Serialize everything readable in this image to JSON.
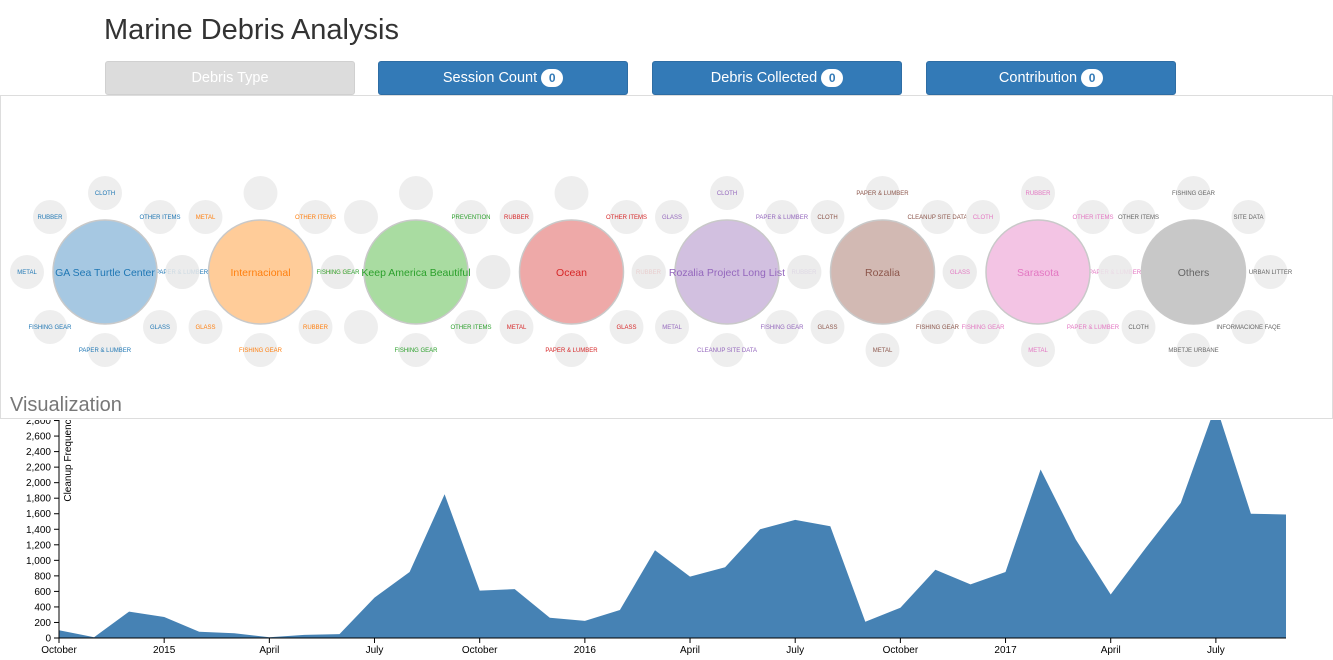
{
  "header": {
    "title": "Marine Debris Analysis"
  },
  "tabs": [
    {
      "label": "Debris Type",
      "badge": null
    },
    {
      "label": "Session Count",
      "badge": "0"
    },
    {
      "label": "Debris Collected",
      "badge": "0"
    },
    {
      "label": "Contribution",
      "badge": "0"
    }
  ],
  "section": {
    "label": "Visualization"
  },
  "groups": [
    {
      "name": "GA Sea Turtle Center",
      "color": "#a6c8e2",
      "text_color": "#1f77b4",
      "satellites": [
        "CLOTH",
        "OTHER ITEMS",
        "PAPER & LUMBER",
        "GLASS",
        "PAPER & LUMBER",
        "FISHING GEAR",
        "METAL",
        "RUBBER"
      ]
    },
    {
      "name": "Internacional",
      "color": "#ffcc99",
      "text_color": "#ff7f0e",
      "satellites": [
        "",
        "OTHER ITEMS",
        "PLASTIC",
        "RUBBER",
        "FISHING GEAR",
        "GLASS",
        "",
        "METAL"
      ]
    },
    {
      "name": "Keep America Beautiful",
      "color": "#a9dca1",
      "text_color": "#2ca02c",
      "satellites": [
        "",
        "PREVENTION",
        "",
        "OTHER ITEMS",
        "FISHING GEAR",
        "",
        "FISHING GEAR",
        ""
      ]
    },
    {
      "name": "Ocean",
      "color": "#eea9a8",
      "text_color": "#d62728",
      "satellites": [
        "",
        "OTHER ITEMS",
        "RUBBER",
        "GLASS",
        "PAPER & LUMBER",
        "METAL",
        "",
        "RUBBER"
      ]
    },
    {
      "name": "Rozalia Project Long List",
      "color": "#d2c0e0",
      "text_color": "#9467bd",
      "satellites": [
        "CLOTH",
        "PAPER & LUMBER",
        "RUBBER",
        "FISHING GEAR",
        "CLEANUP SITE DATA",
        "METAL",
        "",
        "GLASS"
      ]
    },
    {
      "name": "Rozalia",
      "color": "#d2b9b3",
      "text_color": "#8c564b",
      "satellites": [
        "PAPER & LUMBER",
        "CLEANUP SITE DATA",
        "",
        "FISHING GEAR",
        "METAL",
        "GLASS",
        "",
        "CLOTH"
      ]
    },
    {
      "name": "Sarasota",
      "color": "#f3c4e4",
      "text_color": "#e377c2",
      "satellites": [
        "RUBBER",
        "OTHER ITEMS",
        "PAPER & LUMBER",
        "PAPER & LUMBER",
        "METAL",
        "FISHING GEAR",
        "GLASS",
        "CLOTH"
      ]
    },
    {
      "name": "Others",
      "color": "#c8c8c8",
      "text_color": "#666666",
      "satellites": [
        "FISHING GEAR",
        "SITE DATA",
        "URBAN LITTER",
        "INFORMACIONE FAQE",
        "MBETJE URBANE",
        "CLOTH",
        "",
        "OTHER ITEMS"
      ]
    }
  ],
  "chart_data": {
    "type": "area",
    "ylabel": "Cleanup Frequency",
    "ylim": [
      0,
      3000
    ],
    "yticks": [
      0,
      200,
      400,
      600,
      800,
      1000,
      1200,
      1400,
      1600,
      1800,
      2000,
      2200,
      2400,
      2600,
      2800
    ],
    "ytick_labels": [
      "0",
      "200",
      "400",
      "600",
      "800",
      "1,000",
      "1,200",
      "1,400",
      "1,600",
      "1,800",
      "2,000",
      "2,200",
      "2,400",
      "2,600",
      "2,800"
    ],
    "x_start": "2014-10",
    "x_end": "2017-09",
    "xtick_labels": [
      "October",
      "2015",
      "April",
      "July",
      "October",
      "2016",
      "April",
      "July",
      "October",
      "2017",
      "April",
      "July"
    ],
    "series": [
      {
        "color": "#4682b4",
        "points": [
          [
            "2014-10",
            100
          ],
          [
            "2014-11",
            10
          ],
          [
            "2014-12",
            340
          ],
          [
            "2015-01",
            270
          ],
          [
            "2015-02",
            80
          ],
          [
            "2015-03",
            60
          ],
          [
            "2015-04",
            10
          ],
          [
            "2015-05",
            40
          ],
          [
            "2015-06",
            50
          ],
          [
            "2015-07",
            520
          ],
          [
            "2015-08",
            850
          ],
          [
            "2015-09",
            1850
          ],
          [
            "2015-10",
            610
          ],
          [
            "2015-11",
            630
          ],
          [
            "2015-12",
            260
          ],
          [
            "2016-01",
            220
          ],
          [
            "2016-02",
            360
          ],
          [
            "2016-03",
            1130
          ],
          [
            "2016-04",
            790
          ],
          [
            "2016-05",
            910
          ],
          [
            "2016-06",
            1400
          ],
          [
            "2016-07",
            1520
          ],
          [
            "2016-08",
            1440
          ],
          [
            "2016-09",
            210
          ],
          [
            "2016-10",
            390
          ],
          [
            "2016-11",
            880
          ],
          [
            "2016-12",
            690
          ],
          [
            "2017-01",
            850
          ],
          [
            "2017-02",
            2170
          ],
          [
            "2017-03",
            1270
          ],
          [
            "2017-04",
            560
          ],
          [
            "2017-05",
            1160
          ],
          [
            "2017-06",
            1740
          ],
          [
            "2017-07",
            3000
          ],
          [
            "2017-08",
            1600
          ],
          [
            "2017-09",
            1590
          ],
          [
            "2017-10",
            1820
          ]
        ]
      }
    ]
  }
}
